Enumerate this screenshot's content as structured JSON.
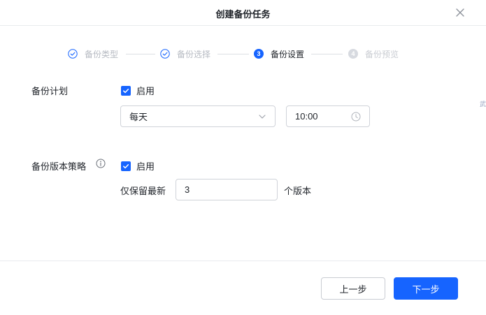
{
  "dialog": {
    "title": "创建备份任务"
  },
  "steps": [
    {
      "label": "备份类型",
      "state": "done"
    },
    {
      "label": "备份选择",
      "state": "done"
    },
    {
      "label": "备份设置",
      "state": "current",
      "number": "3"
    },
    {
      "label": "备份预览",
      "state": "todo",
      "number": "4"
    }
  ],
  "schedule": {
    "label": "备份计划",
    "enable_label": "启用",
    "enabled": true,
    "frequency": "每天",
    "time": "10:00"
  },
  "version_policy": {
    "label": "备份版本策略",
    "enable_label": "启用",
    "enabled": true,
    "keep_label": "仅保留最新",
    "keep_count": "3",
    "unit": "个版本"
  },
  "footer": {
    "prev_label": "上一步",
    "next_label": "下一步"
  },
  "edge_text": "武",
  "colors": {
    "primary": "#1664ff",
    "border": "#d0d3d9",
    "done_text": "#b6bac2"
  },
  "icons": {
    "close": "close-icon",
    "check_circle": "check-circle-icon",
    "chevron": "chevron-down-icon",
    "clock": "clock-icon",
    "info": "info-icon"
  }
}
